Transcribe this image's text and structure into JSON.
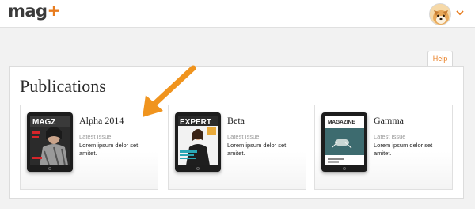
{
  "app": {
    "logo_text": "mag",
    "logo_plus": "+"
  },
  "header": {
    "help_label": "Help"
  },
  "page": {
    "title": "Publications"
  },
  "publications": [
    {
      "name": "Alpha 2014",
      "issue_label": "Latest Issue",
      "issue_text": "Lorem ipsum delor set amitet.",
      "cover_title": "MAGZ"
    },
    {
      "name": "Beta",
      "issue_label": "Latest Issue",
      "issue_text": "Lorem ipsum delor set amitet.",
      "cover_title": "EXPERT"
    },
    {
      "name": "Gamma",
      "issue_label": "Latest Issue",
      "issue_text": "Lorem ipsum delor set amitet.",
      "cover_title": "MAGAZINE"
    }
  ],
  "colors": {
    "accent": "#e87c1e",
    "arrow": "#f0941e"
  },
  "icons": {
    "user_menu": "chevron-down-icon",
    "avatar": "dog-avatar"
  }
}
